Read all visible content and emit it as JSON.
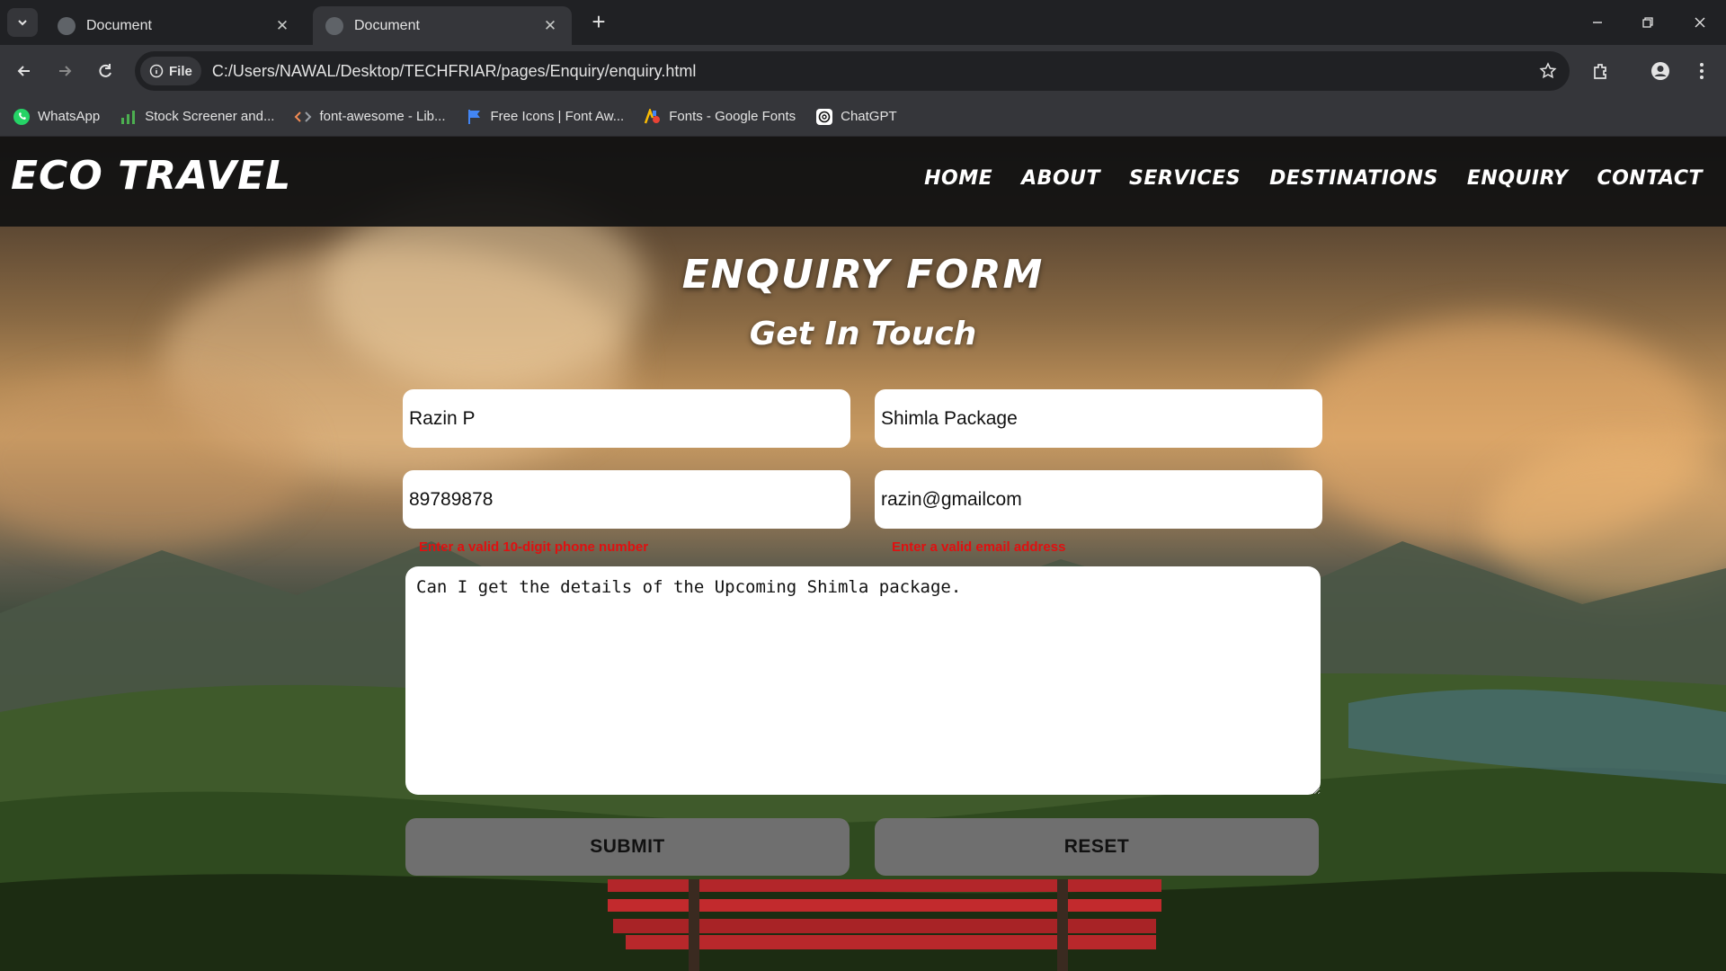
{
  "browser": {
    "tabs": [
      {
        "title": "Document",
        "active": false
      },
      {
        "title": "Document",
        "active": true
      }
    ],
    "file_chip": "File",
    "url": "C:/Users/NAWAL/Desktop/TECHFRIAR/pages/Enquiry/enquiry.html",
    "bookmarks": [
      {
        "label": "WhatsApp",
        "icon": "whatsapp-icon"
      },
      {
        "label": "Stock Screener and...",
        "icon": "bar-chart-icon"
      },
      {
        "label": "font-awesome - Lib...",
        "icon": "code-icon"
      },
      {
        "label": "Free Icons | Font Aw...",
        "icon": "flag-icon"
      },
      {
        "label": "Fonts - Google Fonts",
        "icon": "google-fonts-icon"
      },
      {
        "label": "ChatGPT",
        "icon": "chatgpt-icon"
      }
    ]
  },
  "site": {
    "logo": "ECO TRAVEL",
    "nav": [
      "HOME",
      "ABOUT",
      "SERVICES",
      "DESTINATIONS",
      "ENQUIRY",
      "CONTACT"
    ]
  },
  "form": {
    "title": "ENQUIRY FORM",
    "subtitle": "Get In Touch",
    "name_value": "Razin P",
    "package_value": "Shimla Package",
    "phone_value": "89789878",
    "email_value": "razin@gmailcom",
    "phone_error": "Enter a valid 10-digit phone number",
    "email_error": "Enter a valid email address",
    "message_value": "Can I get the details of the Upcoming Shimla package.",
    "submit_label": "SUBMIT",
    "reset_label": "RESET"
  },
  "colors": {
    "error": "#e01010",
    "button": "#6f6f6f",
    "header": "#121212"
  }
}
